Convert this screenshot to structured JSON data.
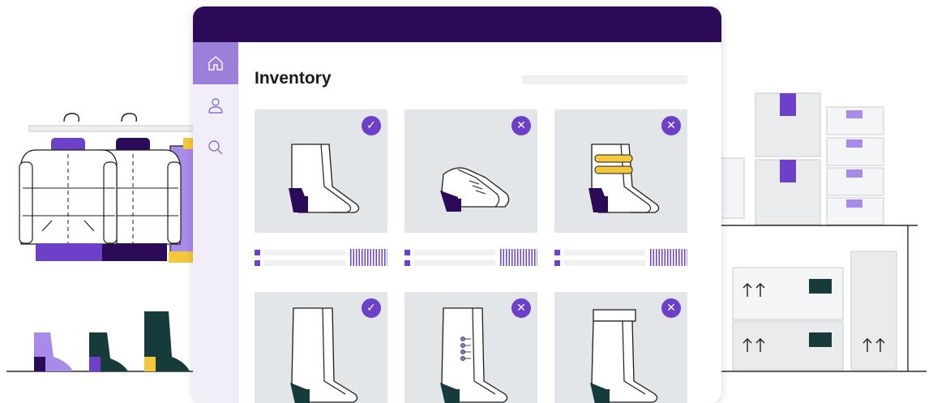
{
  "window": {
    "title_bar_color": "#2b0a57",
    "page_title": "Inventory"
  },
  "sidebar": {
    "items": [
      {
        "name": "home",
        "icon": "home-icon",
        "active": true
      },
      {
        "name": "profile",
        "icon": "user-icon",
        "active": false
      },
      {
        "name": "search",
        "icon": "search-icon",
        "active": false
      }
    ]
  },
  "products": [
    {
      "item": "heeled ankle boot",
      "status": "approved",
      "badge": "✓"
    },
    {
      "item": "heeled lace-up shoe",
      "status": "rejected",
      "badge": "✕"
    },
    {
      "item": "buckled ankle boot",
      "status": "rejected",
      "badge": "✕"
    },
    {
      "item": "tall heeled boot",
      "status": "approved",
      "badge": "✓"
    },
    {
      "item": "button knee boot",
      "status": "rejected",
      "badge": "✕"
    },
    {
      "item": "cuffed knee boot",
      "status": "rejected",
      "badge": "✕"
    }
  ],
  "colors": {
    "accent": "#6c40c8",
    "sidebar_active": "#9b7fd8",
    "card_background": "#e3e6e9",
    "dark_teal": "#173b3b",
    "yellow": "#f3c83b"
  }
}
